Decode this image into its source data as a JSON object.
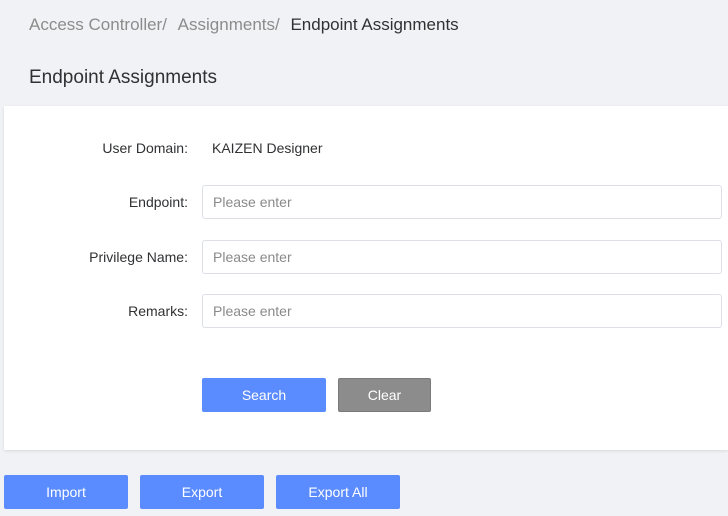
{
  "breadcrumb": {
    "items": [
      "Access Controller/",
      "Assignments/"
    ],
    "current": "Endpoint Assignments"
  },
  "page": {
    "title": "Endpoint Assignments"
  },
  "form": {
    "user_domain": {
      "label": "User Domain:",
      "value": "KAIZEN Designer"
    },
    "endpoint": {
      "label": "Endpoint:",
      "value": "",
      "placeholder": "Please enter"
    },
    "privilege_name": {
      "label": "Privilege Name:",
      "value": "",
      "placeholder": "Please enter"
    },
    "remarks": {
      "label": "Remarks:",
      "value": "",
      "placeholder": "Please enter"
    },
    "search_label": "Search",
    "clear_label": "Clear"
  },
  "actions": {
    "import_label": "Import",
    "export_label": "Export",
    "export_all_label": "Export All"
  },
  "colors": {
    "primary": "#5b8cff",
    "secondary": "#8c8c8c",
    "background": "#f0f2f5"
  }
}
